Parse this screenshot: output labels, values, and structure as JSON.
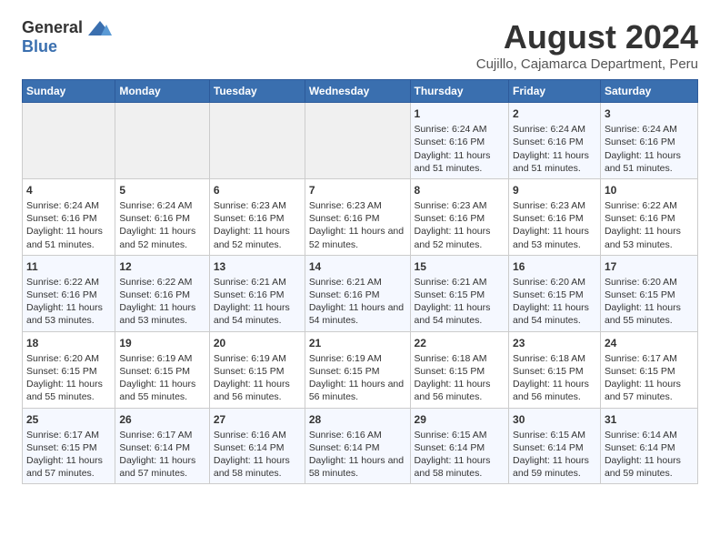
{
  "logo": {
    "general": "General",
    "blue": "Blue"
  },
  "title": "August 2024",
  "subtitle": "Cujillo, Cajamarca Department, Peru",
  "days_of_week": [
    "Sunday",
    "Monday",
    "Tuesday",
    "Wednesday",
    "Thursday",
    "Friday",
    "Saturday"
  ],
  "weeks": [
    [
      {
        "day": "",
        "content": ""
      },
      {
        "day": "",
        "content": ""
      },
      {
        "day": "",
        "content": ""
      },
      {
        "day": "",
        "content": ""
      },
      {
        "day": "1",
        "content": "Sunrise: 6:24 AM\nSunset: 6:16 PM\nDaylight: 11 hours and 51 minutes."
      },
      {
        "day": "2",
        "content": "Sunrise: 6:24 AM\nSunset: 6:16 PM\nDaylight: 11 hours and 51 minutes."
      },
      {
        "day": "3",
        "content": "Sunrise: 6:24 AM\nSunset: 6:16 PM\nDaylight: 11 hours and 51 minutes."
      }
    ],
    [
      {
        "day": "4",
        "content": "Sunrise: 6:24 AM\nSunset: 6:16 PM\nDaylight: 11 hours and 51 minutes."
      },
      {
        "day": "5",
        "content": "Sunrise: 6:24 AM\nSunset: 6:16 PM\nDaylight: 11 hours and 52 minutes."
      },
      {
        "day": "6",
        "content": "Sunrise: 6:23 AM\nSunset: 6:16 PM\nDaylight: 11 hours and 52 minutes."
      },
      {
        "day": "7",
        "content": "Sunrise: 6:23 AM\nSunset: 6:16 PM\nDaylight: 11 hours and 52 minutes."
      },
      {
        "day": "8",
        "content": "Sunrise: 6:23 AM\nSunset: 6:16 PM\nDaylight: 11 hours and 52 minutes."
      },
      {
        "day": "9",
        "content": "Sunrise: 6:23 AM\nSunset: 6:16 PM\nDaylight: 11 hours and 53 minutes."
      },
      {
        "day": "10",
        "content": "Sunrise: 6:22 AM\nSunset: 6:16 PM\nDaylight: 11 hours and 53 minutes."
      }
    ],
    [
      {
        "day": "11",
        "content": "Sunrise: 6:22 AM\nSunset: 6:16 PM\nDaylight: 11 hours and 53 minutes."
      },
      {
        "day": "12",
        "content": "Sunrise: 6:22 AM\nSunset: 6:16 PM\nDaylight: 11 hours and 53 minutes."
      },
      {
        "day": "13",
        "content": "Sunrise: 6:21 AM\nSunset: 6:16 PM\nDaylight: 11 hours and 54 minutes."
      },
      {
        "day": "14",
        "content": "Sunrise: 6:21 AM\nSunset: 6:16 PM\nDaylight: 11 hours and 54 minutes."
      },
      {
        "day": "15",
        "content": "Sunrise: 6:21 AM\nSunset: 6:15 PM\nDaylight: 11 hours and 54 minutes."
      },
      {
        "day": "16",
        "content": "Sunrise: 6:20 AM\nSunset: 6:15 PM\nDaylight: 11 hours and 54 minutes."
      },
      {
        "day": "17",
        "content": "Sunrise: 6:20 AM\nSunset: 6:15 PM\nDaylight: 11 hours and 55 minutes."
      }
    ],
    [
      {
        "day": "18",
        "content": "Sunrise: 6:20 AM\nSunset: 6:15 PM\nDaylight: 11 hours and 55 minutes."
      },
      {
        "day": "19",
        "content": "Sunrise: 6:19 AM\nSunset: 6:15 PM\nDaylight: 11 hours and 55 minutes."
      },
      {
        "day": "20",
        "content": "Sunrise: 6:19 AM\nSunset: 6:15 PM\nDaylight: 11 hours and 56 minutes."
      },
      {
        "day": "21",
        "content": "Sunrise: 6:19 AM\nSunset: 6:15 PM\nDaylight: 11 hours and 56 minutes."
      },
      {
        "day": "22",
        "content": "Sunrise: 6:18 AM\nSunset: 6:15 PM\nDaylight: 11 hours and 56 minutes."
      },
      {
        "day": "23",
        "content": "Sunrise: 6:18 AM\nSunset: 6:15 PM\nDaylight: 11 hours and 56 minutes."
      },
      {
        "day": "24",
        "content": "Sunrise: 6:17 AM\nSunset: 6:15 PM\nDaylight: 11 hours and 57 minutes."
      }
    ],
    [
      {
        "day": "25",
        "content": "Sunrise: 6:17 AM\nSunset: 6:15 PM\nDaylight: 11 hours and 57 minutes."
      },
      {
        "day": "26",
        "content": "Sunrise: 6:17 AM\nSunset: 6:14 PM\nDaylight: 11 hours and 57 minutes."
      },
      {
        "day": "27",
        "content": "Sunrise: 6:16 AM\nSunset: 6:14 PM\nDaylight: 11 hours and 58 minutes."
      },
      {
        "day": "28",
        "content": "Sunrise: 6:16 AM\nSunset: 6:14 PM\nDaylight: 11 hours and 58 minutes."
      },
      {
        "day": "29",
        "content": "Sunrise: 6:15 AM\nSunset: 6:14 PM\nDaylight: 11 hours and 58 minutes."
      },
      {
        "day": "30",
        "content": "Sunrise: 6:15 AM\nSunset: 6:14 PM\nDaylight: 11 hours and 59 minutes."
      },
      {
        "day": "31",
        "content": "Sunrise: 6:14 AM\nSunset: 6:14 PM\nDaylight: 11 hours and 59 minutes."
      }
    ]
  ]
}
